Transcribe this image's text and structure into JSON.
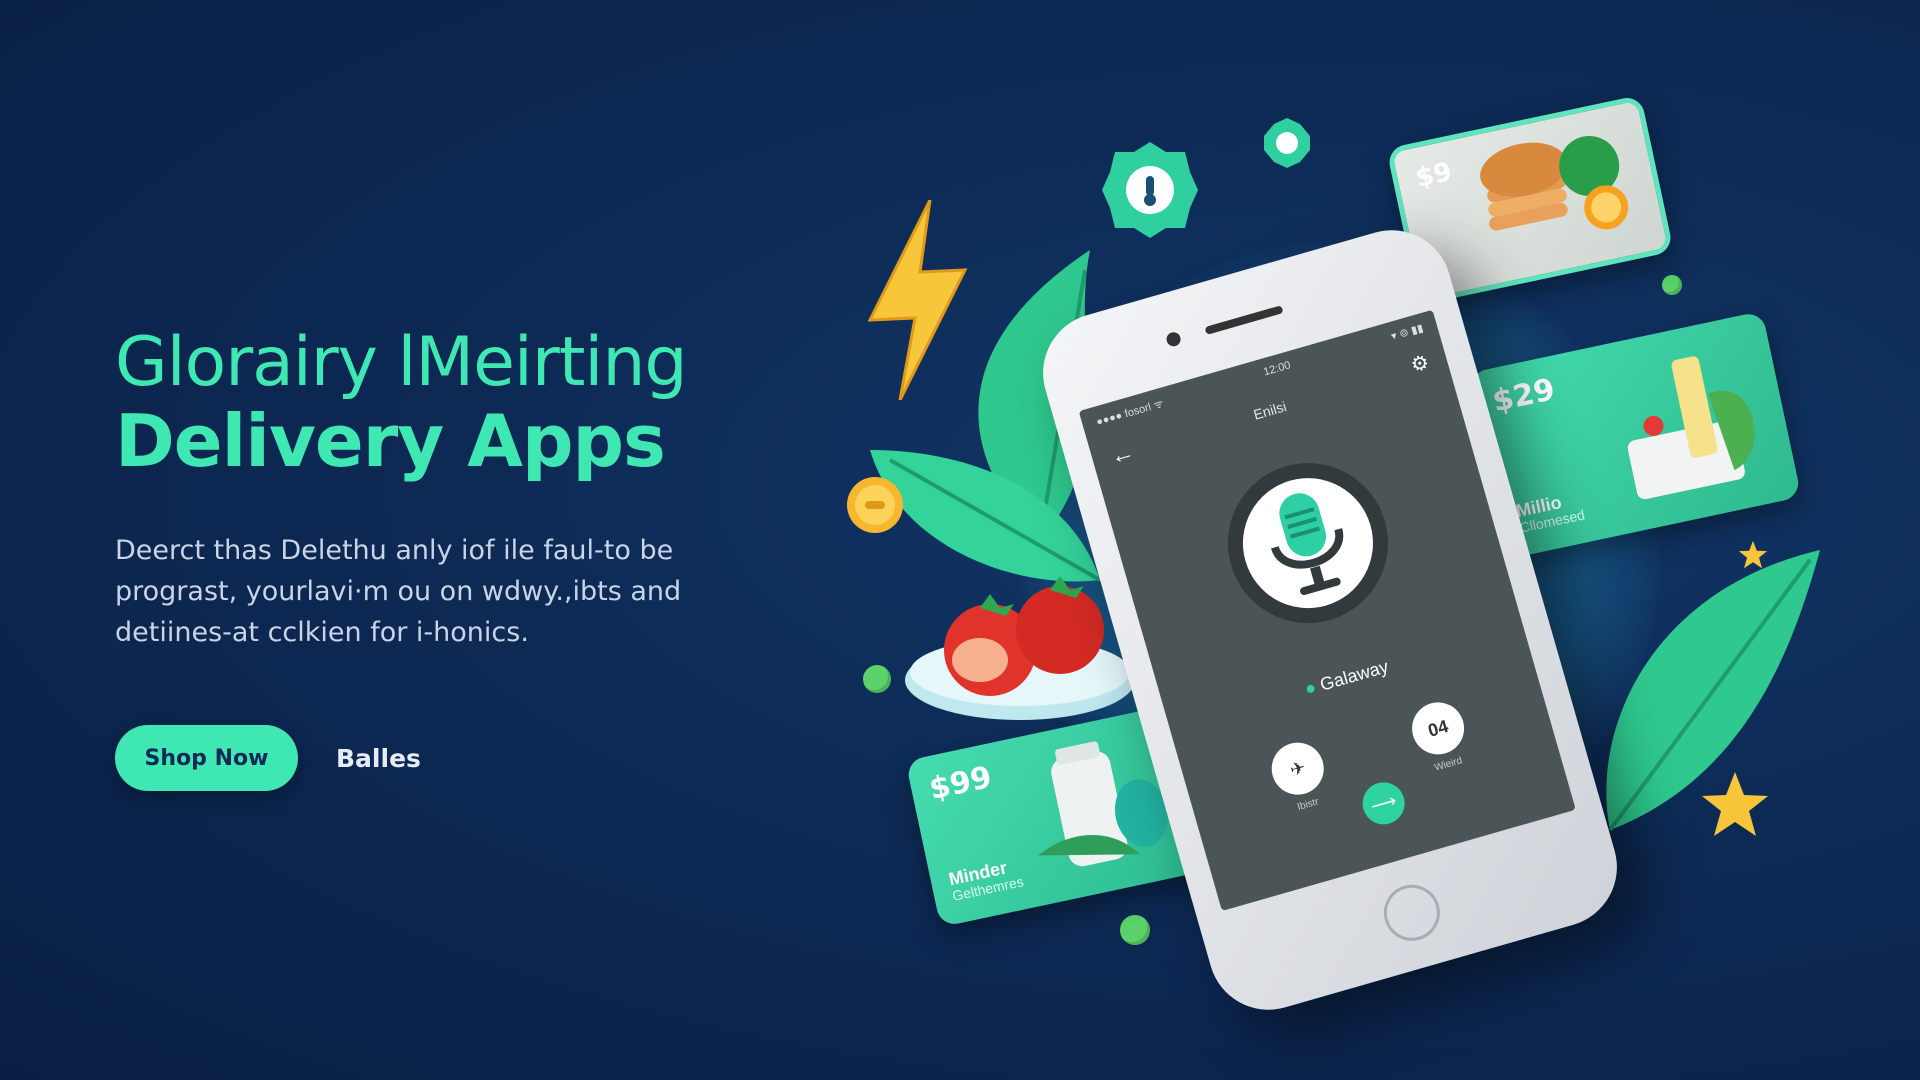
{
  "hero": {
    "title_line1": "Glorairy lMeirting",
    "title_line2": "Delivery Apps",
    "description": "Deerct thas Delethu anly iof ile faul-to be prograst, yourlavi·m ou on wdwy.,ibts and detiines-at cclkien for i-honics."
  },
  "cta": {
    "primary_label": "Shop Now",
    "secondary_label": "Balles"
  },
  "phone": {
    "status_left": "●●●● fosorl ᯤ",
    "status_center": "12:00",
    "status_right": "▾ ⊚ ▮▮",
    "screen_title": "Enilsi",
    "user_name": "Galaway",
    "left_button_label": "Ibistr",
    "right_button_text": "04",
    "right_button_label": "Wieird"
  },
  "cards": {
    "top_price": "$9",
    "right_price": "$29",
    "right_name": "Millio",
    "right_sub": "Cllomesed",
    "bottom_price": "$99",
    "bottom_name": "Minder",
    "bottom_sub": "Gelthemres"
  },
  "colors": {
    "accent": "#3fe7b3",
    "background": "#0d2a55",
    "card_green": "#3ccfa3"
  }
}
